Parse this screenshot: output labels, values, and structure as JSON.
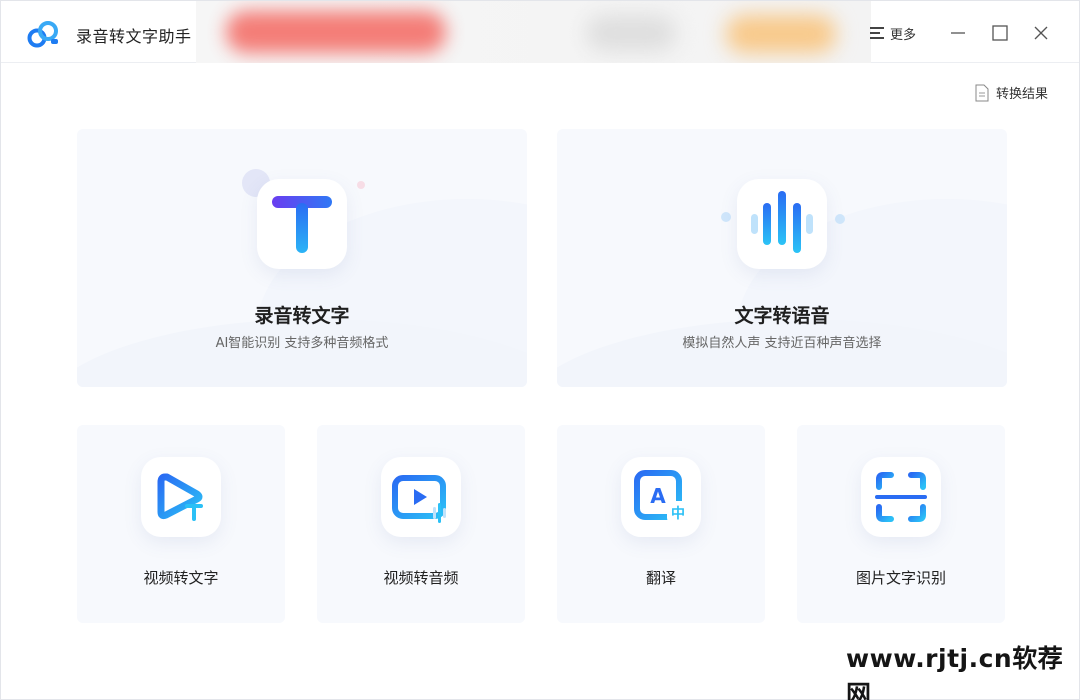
{
  "app": {
    "title": "录音转文字助手"
  },
  "toolbar": {
    "more_label": "更多"
  },
  "result_link": {
    "label": "转换结果"
  },
  "features_main": [
    {
      "title": "录音转文字",
      "subtitle": "AI智能识别 支持多种音频格式",
      "icon": "text-t-icon"
    },
    {
      "title": "文字转语音",
      "subtitle": "模拟自然人声 支持近百种声音选择",
      "icon": "soundwave-icon"
    }
  ],
  "features_small": [
    {
      "title": "视频转文字",
      "icon": "video-to-text-icon"
    },
    {
      "title": "视频转音频",
      "icon": "video-to-audio-icon"
    },
    {
      "title": "翻译",
      "icon": "translate-icon"
    },
    {
      "title": "图片文字识别",
      "icon": "image-ocr-icon"
    }
  ],
  "colors": {
    "accent": "#1e7cf2",
    "accent_light": "#39b8f5",
    "card_bg": "#f7f9fd"
  },
  "watermark": "www.rjtj.cn软荐网"
}
